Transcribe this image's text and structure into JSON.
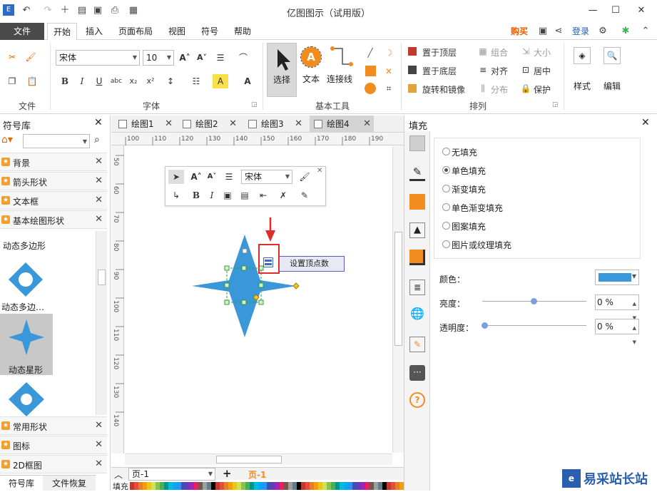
{
  "window": {
    "title": "亿图图示（试用版）",
    "minimize": "—",
    "maximize": "☐",
    "close": "✕"
  },
  "menubar": {
    "file": "文件",
    "items": [
      "开始",
      "插入",
      "页面布局",
      "视图",
      "符号",
      "帮助"
    ],
    "buy": "购买",
    "login": "登录"
  },
  "ribbon": {
    "groups": {
      "file": "文件",
      "font": "字体",
      "tools": "基本工具",
      "arrange": "排列"
    },
    "font_name": "宋体",
    "font_size": "10",
    "select": "选择",
    "text": "文本",
    "connector": "连接线",
    "arrange": {
      "bring_front": "置于顶层",
      "send_back": "置于底层",
      "rotate": "旋转和镜像",
      "group": "组合",
      "align": "对齐",
      "distribute": "分布",
      "size": "大小",
      "center": "居中",
      "protect": "保护"
    },
    "style": "样式",
    "edit": "编辑"
  },
  "left_panel": {
    "title": "符号库",
    "categories": [
      "背景",
      "箭头形状",
      "文本框",
      "基本绘图形状"
    ],
    "shapes": [
      {
        "label": "动态多边形"
      },
      {
        "label": "动态多边…"
      },
      {
        "label": "动态星形"
      }
    ],
    "bottom_categories": [
      "常用形状",
      "图标",
      "2D框图"
    ],
    "bottom_tabs": [
      "符号库",
      "文件恢复"
    ]
  },
  "doc_tabs": [
    "绘图1",
    "绘图2",
    "绘图3",
    "绘图4"
  ],
  "ruler": {
    "h_ticks": [
      "100",
      "110",
      "120",
      "130",
      "140",
      "150",
      "160",
      "170",
      "180",
      "190"
    ],
    "v_ticks": [
      "50",
      "60",
      "70",
      "80",
      "90",
      "100",
      "110",
      "120",
      "130",
      "140"
    ]
  },
  "floating_toolbar": {
    "font": "宋体"
  },
  "tooltip": {
    "text": "设置顶点数"
  },
  "page_nav": {
    "page": "页-1",
    "active_page": "页-1"
  },
  "colors": {
    "shape_fill": "#3a97d9",
    "accent_orange": "#f28c1e",
    "highlight_red": "#e22b2b"
  },
  "right_panel": {
    "title": "填充",
    "options": [
      {
        "label": "无填充",
        "selected": false
      },
      {
        "label": "单色填充",
        "selected": true
      },
      {
        "label": "渐变填充",
        "selected": false
      },
      {
        "label": "单色渐变填充",
        "selected": false
      },
      {
        "label": "图案填充",
        "selected": false
      },
      {
        "label": "图片或纹理填充",
        "selected": false
      }
    ],
    "color_label": "颜色：",
    "brightness_label": "亮度：",
    "brightness_value": "0 %",
    "transparency_label": "透明度：",
    "transparency_value": "0 %"
  },
  "statusbar": {
    "fill_label": "填充"
  },
  "watermark": {
    "text": "易采站长站"
  }
}
